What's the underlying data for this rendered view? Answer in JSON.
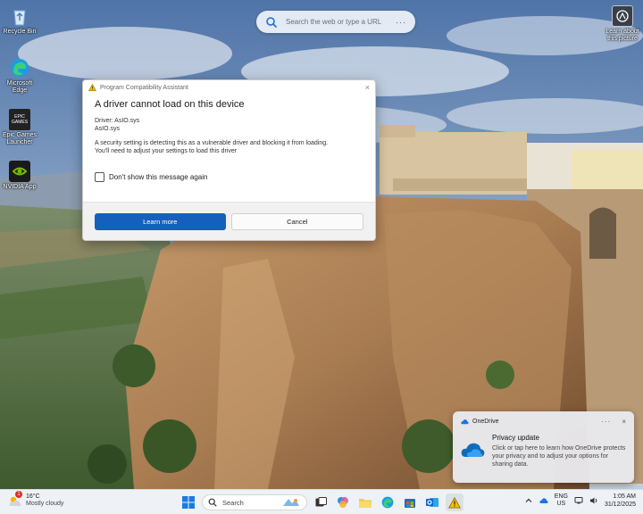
{
  "desktop": {
    "search_placeholder": "Search the web or type a URL",
    "search_more": "···",
    "icons": [
      {
        "label": "Recycle Bin",
        "icon": "recycle-bin-icon"
      },
      {
        "label": "Microsoft Edge",
        "icon": "edge-icon"
      },
      {
        "label": "Epic Games Launcher",
        "icon": "epic-games-icon",
        "badge_text": "EPIC GAMES"
      },
      {
        "label": "NVIDIA App",
        "icon": "nvidia-icon"
      }
    ],
    "learn_icon_label": "Learn about this picture"
  },
  "dialog": {
    "title": "Program Compatibility Assistant",
    "close_glyph": "×",
    "heading": "A driver cannot load on this device",
    "driver_line": "Driver: AsIO.sys",
    "file_line": "AsIO.sys",
    "message_line1": "A security setting is detecting this as a vulnerable driver and blocking it from loading.",
    "message_line2": "You'll need to adjust your settings to load this driver",
    "checkbox_label": "Don't show this message again",
    "checkbox_checked": false,
    "primary_button": "Learn more",
    "secondary_button": "Cancel",
    "accent": "#1560bd"
  },
  "toast": {
    "app": "OneDrive",
    "more": "···",
    "close": "×",
    "title": "Privacy update",
    "text": "Click or tap here to learn how OneDrive protects your privacy and to adjust your options for sharing data."
  },
  "taskbar": {
    "weather_badge": "1",
    "temperature": "16°C",
    "condition": "Mostly cloudy",
    "search_label": "Search",
    "apps": [
      "start-icon",
      "taskbar-search",
      "task-view-icon",
      "copilot-icon",
      "file-explorer-icon",
      "edge-icon",
      "store-icon",
      "outlook-icon",
      "warning-app-icon"
    ],
    "lang_top": "ENG",
    "lang_bottom": "US",
    "time": "1:05 AM",
    "date": "31/12/2025"
  }
}
